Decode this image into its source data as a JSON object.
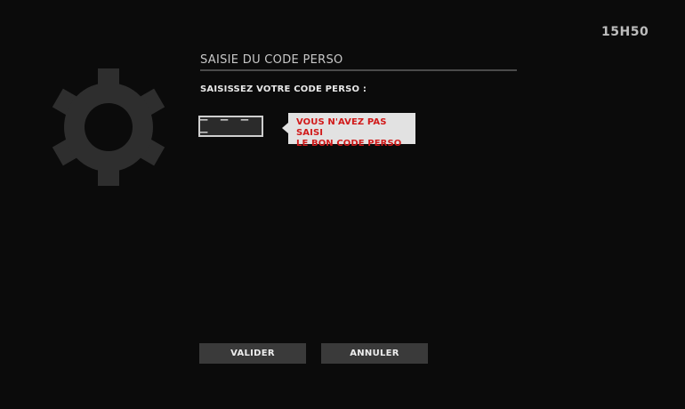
{
  "status": {
    "clock": "15H50"
  },
  "page": {
    "title": "SAISIE DU CODE PERSO",
    "prompt": "SAISISSEZ VOTRE CODE PERSO :",
    "settings_icon": "gear-icon"
  },
  "code_input": {
    "value": "_ _ _ _"
  },
  "error": {
    "line1": "VOUS N'AVEZ PAS SAISI",
    "line2": "LE BON CODE PERSO",
    "color": "#d11a1a"
  },
  "actions": {
    "validate_label": "VALIDER",
    "cancel_label": "ANNULER"
  },
  "colors": {
    "background": "#0b0b0b",
    "gear": "#2e2e2e",
    "button": "#3a3a3a",
    "bubble": "#e2e2e2"
  }
}
